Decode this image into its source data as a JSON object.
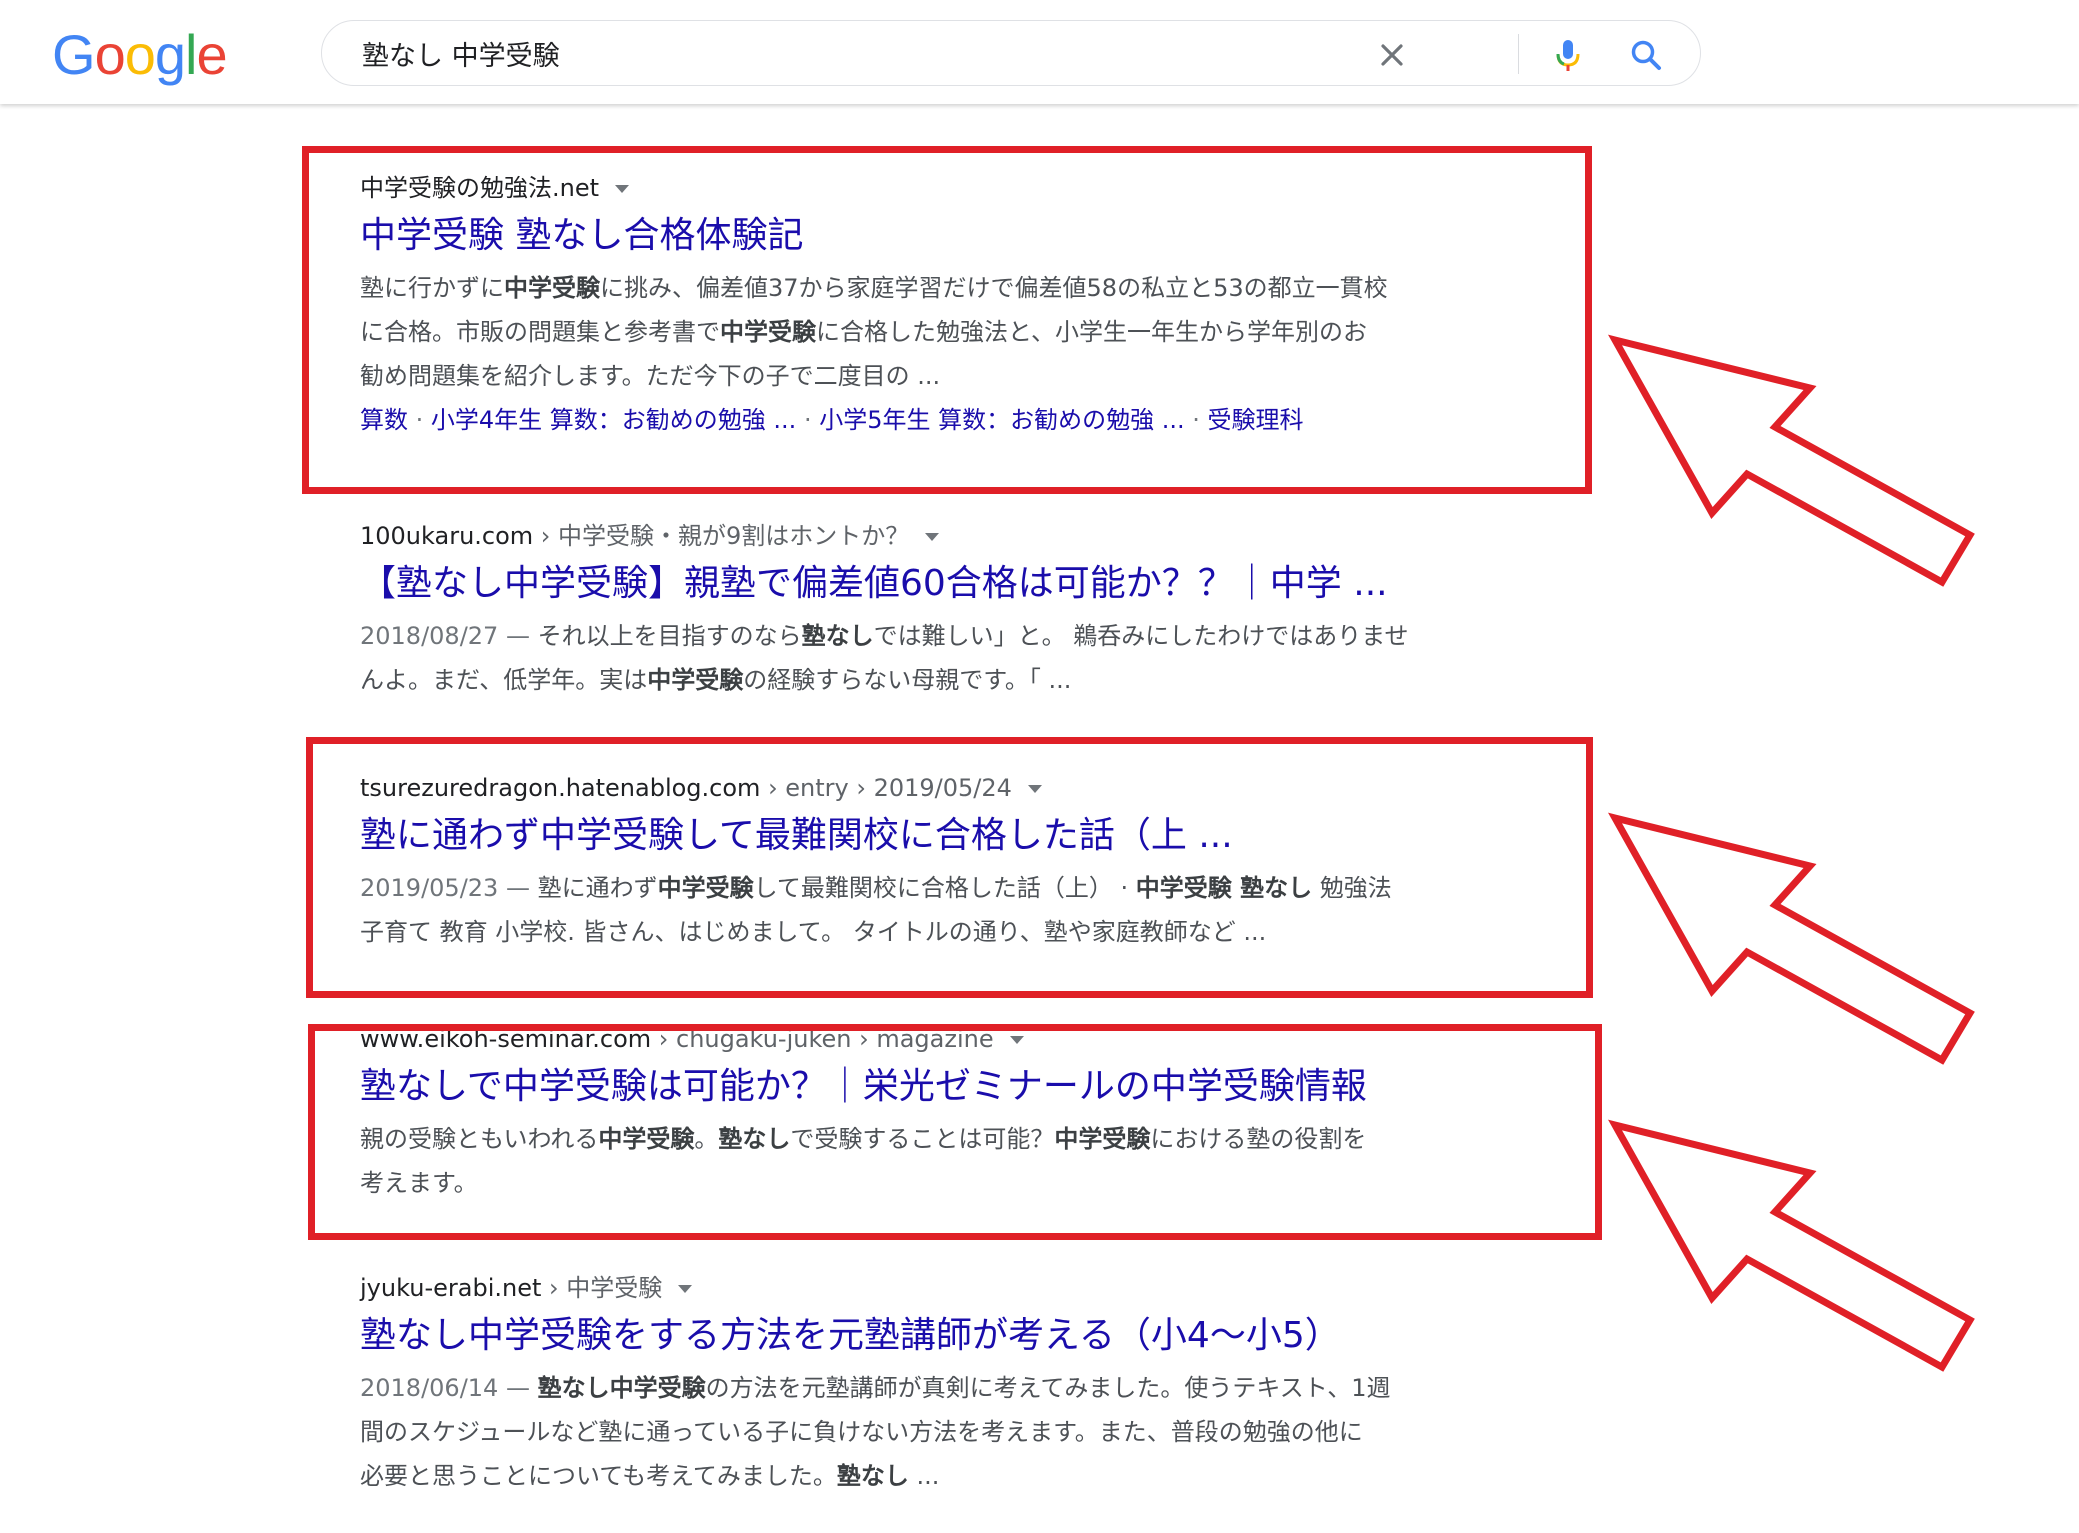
{
  "logo": {
    "letters": [
      "G",
      "o",
      "o",
      "g",
      "l",
      "e"
    ],
    "colors": [
      "#4285F4",
      "#EA4335",
      "#FBBC05",
      "#4285F4",
      "#34A853",
      "#EA4335"
    ]
  },
  "search": {
    "query": "塾なし 中学受験"
  },
  "icons": {
    "clear": "close-icon",
    "voice": "mic-icon",
    "search": "search-icon"
  },
  "results": [
    {
      "site": "中学受験の勉強法.net",
      "title": "中学受験 塾なし合格体験記",
      "snippet": [
        "塾に行かずに",
        {
          "b": "中学受験"
        },
        "に挑み、偏差値37から家庭学習だけで偏差値58の私立と53の都立一貫校",
        "\n",
        "に合格。市販の問題集と参考書で",
        {
          "b": "中学受験"
        },
        "に合格した勉強法と、小学生一年生から学年別のお",
        "\n",
        "勧め問題集を紹介します。ただ今下の子で二度目の ..."
      ],
      "sitelinks": [
        "算数",
        "小学4年生 算数：お勧めの勉強 ...",
        "小学5年生 算数：お勧めの勉強 ...",
        "受験理科"
      ]
    },
    {
      "site": "100ukaru.com",
      "breadcrumb": " › 中学受験・親が9割はホントか？",
      "title": "【塾なし中学受験】親塾で偏差値60合格は可能か？？｜中学 ...",
      "date": "2018/08/27 —",
      "snippet": [
        " それ以上を目指すのなら",
        {
          "b": "塾なし"
        },
        "では難しい」と。 鵜呑みにしたわけではありませ",
        "\n",
        "んよ。まだ、低学年。実は",
        {
          "b": "中学受験"
        },
        "の経験すらない母親です。「 ..."
      ]
    },
    {
      "site": "tsurezuredragon.hatenablog.com",
      "breadcrumb": " › entry › 2019/05/24",
      "title": "塾に通わず中学受験して最難関校に合格した話（上 ...",
      "date": "2019/05/23 —",
      "snippet": [
        " 塾に通わず",
        {
          "b": "中学受験"
        },
        "して最難関校に合格した話（上） · ",
        {
          "b": "中学受験 塾なし"
        },
        " 勉強法",
        "\n",
        "子育て 教育 小学校. 皆さん、はじめまして。 タイトルの通り、塾や家庭教師など ..."
      ]
    },
    {
      "site": "www.eikoh-seminar.com",
      "breadcrumb": " › chugaku-juken › magazine",
      "title": "塾なしで中学受験は可能か？｜栄光ゼミナールの中学受験情報",
      "snippet": [
        "親の受験ともいわれる",
        {
          "b": "中学受験"
        },
        "。",
        {
          "b": "塾なし"
        },
        "で受験することは可能？",
        {
          "b": "中学受験"
        },
        "における塾の役割を",
        "\n",
        "考えます。"
      ]
    },
    {
      "site": "jyuku-erabi.net",
      "breadcrumb": " › 中学受験",
      "title": "塾なし中学受験をする方法を元塾講師が考える（小4〜小5）",
      "date": "2018/06/14 —",
      "snippet": [
        " ",
        {
          "b": "塾なし中学受験"
        },
        "の方法を元塾講師が真剣に考えてみました。使うテキスト、1週",
        "\n",
        "間のスケジュールなど塾に通っている子に負けない方法を考えます。また、普段の勉強の他に",
        "\n",
        "必要と思うことについても考えてみました。",
        {
          "b": "塾なし"
        },
        " ..."
      ]
    }
  ],
  "annotation_color": "#e02027"
}
